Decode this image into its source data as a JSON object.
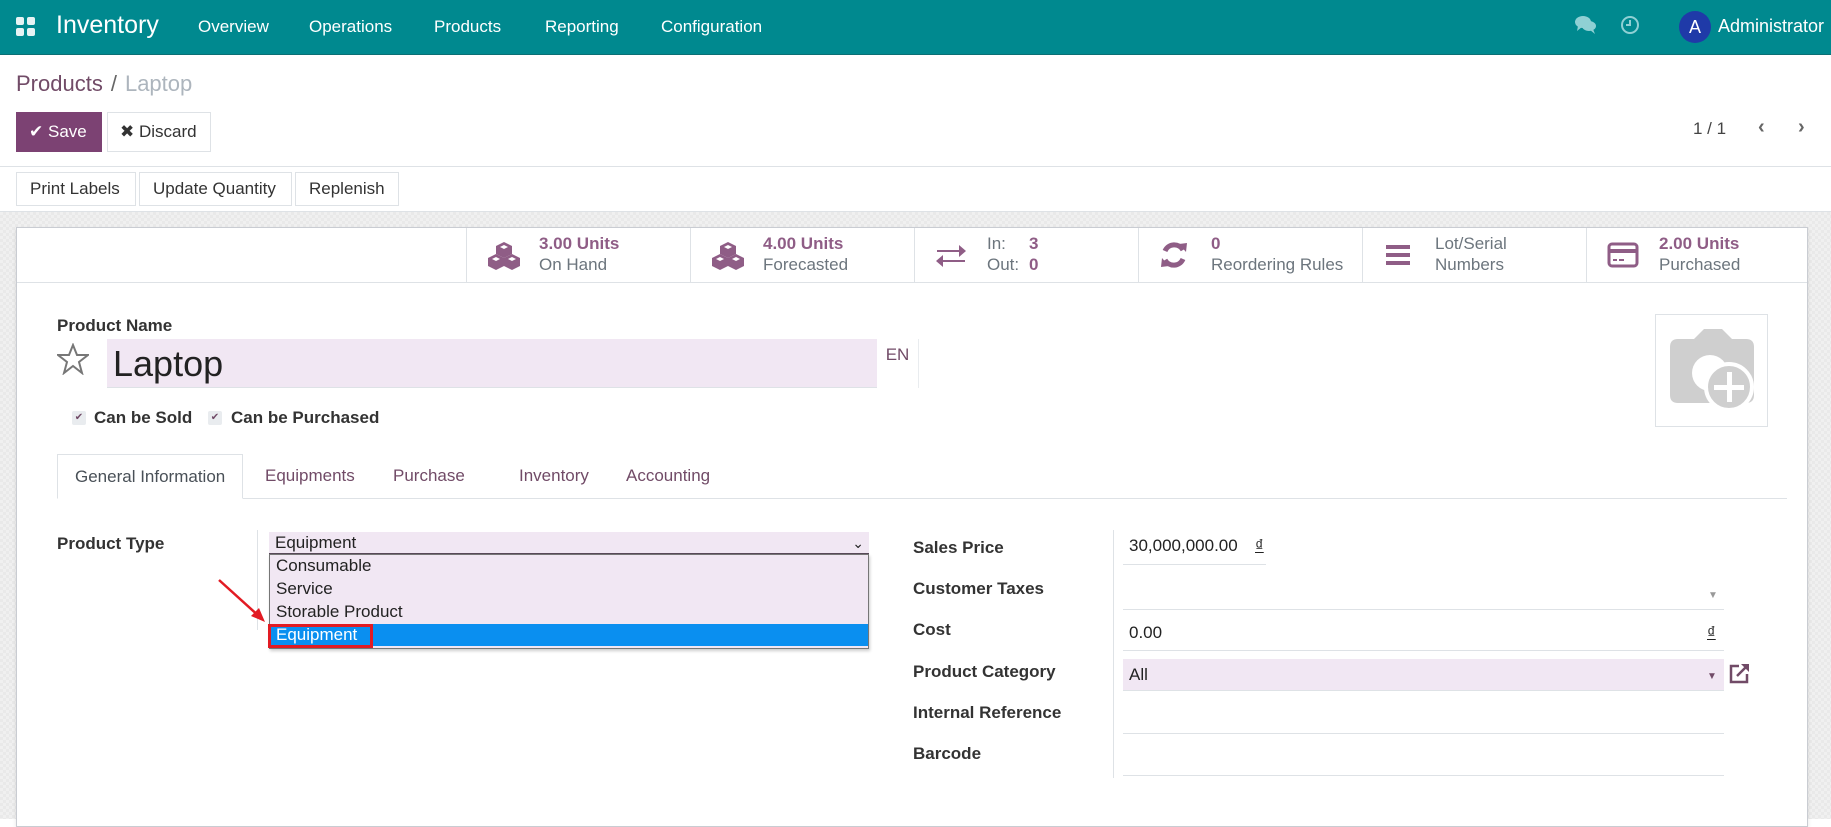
{
  "navbar": {
    "app_name": "Inventory",
    "menu": [
      "Overview",
      "Operations",
      "Products",
      "Reporting",
      "Configuration"
    ],
    "icons": [
      "apps-grid-icon",
      "chat-icon",
      "clock-icon"
    ],
    "user_initial": "A",
    "user_name": "Administrator",
    "colors": {
      "navbar_bg": "#00898f",
      "avatar_bg": "#1f3aa8"
    }
  },
  "breadcrumb": {
    "parent": "Products",
    "separator": "/",
    "current": "Laptop"
  },
  "toolbar": {
    "save_label": "Save",
    "discard_label": "Discard",
    "pager": "1 / 1",
    "colors": {
      "primary": "#7c4273"
    }
  },
  "actions": [
    "Print Labels",
    "Update Quantity",
    "Replenish"
  ],
  "stat_buttons": [
    {
      "icon": "cubes-icon",
      "value": "3.00 Units",
      "label": "On Hand"
    },
    {
      "icon": "cubes-icon",
      "value": "4.00 Units",
      "label": "Forecasted"
    },
    {
      "icon": "exchange-icon",
      "in_label": "In:",
      "in_value": "3",
      "out_label": "Out:",
      "out_value": "0"
    },
    {
      "icon": "refresh-icon",
      "value": "0",
      "label": "Reordering Rules"
    },
    {
      "icon": "bars-icon",
      "label_line1": "Lot/Serial",
      "label_line2": "Numbers"
    },
    {
      "icon": "credit-card-icon",
      "value": "2.00 Units",
      "label": "Purchased"
    }
  ],
  "product": {
    "name_label": "Product Name",
    "name": "Laptop",
    "lang": "EN",
    "can_be_sold_label": "Can be Sold",
    "can_be_sold": true,
    "can_be_purchased_label": "Can be Purchased",
    "can_be_purchased": true
  },
  "tabs": [
    {
      "label": "General Information",
      "active": true
    },
    {
      "label": "Equipments",
      "active": false
    },
    {
      "label": "Purchase",
      "active": false
    },
    {
      "label": "Inventory",
      "active": false
    },
    {
      "label": "Accounting",
      "active": false
    }
  ],
  "general": {
    "product_type_label": "Product Type",
    "product_type_value": "Equipment",
    "product_type_options": [
      "Consumable",
      "Service",
      "Storable Product",
      "Equipment"
    ],
    "product_type_selected_index": 3,
    "sales_price_label": "Sales Price",
    "sales_price": "30,000,000.00",
    "currency": "₫",
    "customer_taxes_label": "Customer Taxes",
    "customer_taxes": "",
    "cost_label": "Cost",
    "cost": "0.00",
    "product_category_label": "Product Category",
    "product_category": "All",
    "internal_reference_label": "Internal Reference",
    "internal_reference": "",
    "barcode_label": "Barcode",
    "barcode": ""
  },
  "annotation": {
    "color": "#e21b23"
  }
}
